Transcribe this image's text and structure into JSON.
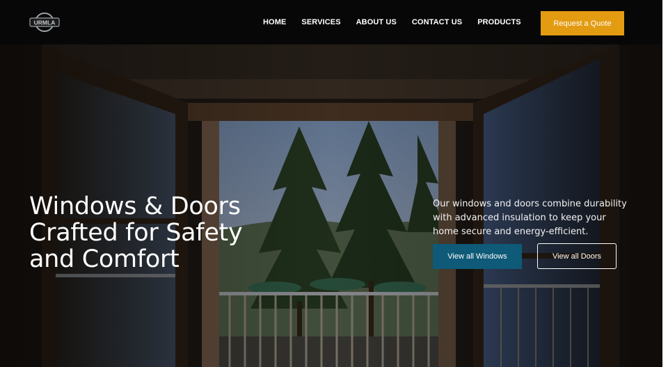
{
  "brand": {
    "logo_text": "URMLA",
    "logo_icon": "brand-badge-icon"
  },
  "nav": {
    "items": [
      {
        "label": "HOME"
      },
      {
        "label": "SERVICES"
      },
      {
        "label": "ABOUT US"
      },
      {
        "label": "CONTACT US"
      },
      {
        "label": "PRODUCTS"
      }
    ],
    "cta_label": "Request a Quote"
  },
  "hero": {
    "title_lines": [
      "Windows & Doors",
      "Crafted for Safety",
      "and Comfort"
    ],
    "description_lines": [
      "Our windows and doors combine durability",
      "with advanced insulation to keep your",
      "home secure and energy-efficient."
    ],
    "primary_button": "View all Windows",
    "secondary_button": "View all Doors"
  },
  "colors": {
    "header_bg": "#070707",
    "accent": "#e39b12",
    "primary_button": "#0e5a78",
    "text": "#ffffff"
  }
}
